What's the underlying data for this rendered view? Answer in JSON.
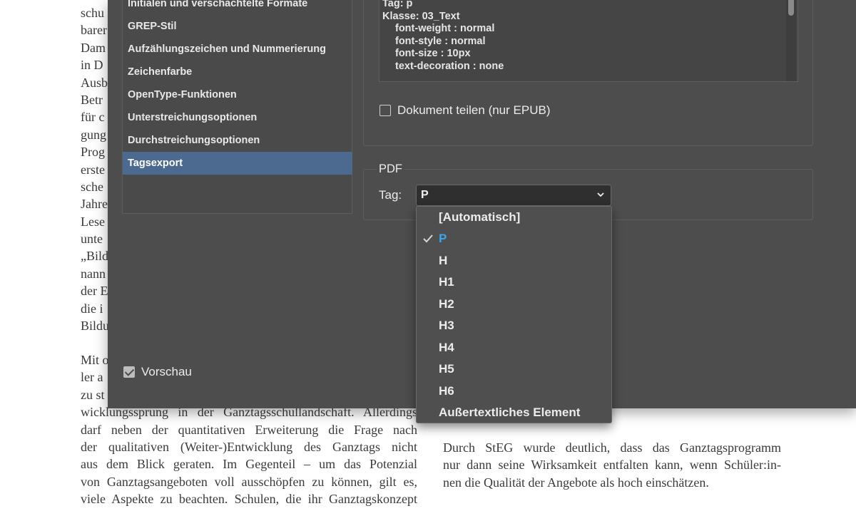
{
  "background_document": {
    "left_column_top": [
      "schu",
      "barer",
      "Dam",
      "in D",
      "Ausb",
      "Betr",
      "für c",
      "gung",
      "Prog",
      "erste",
      "sche",
      "Jahre",
      "Lese",
      "unte",
      "„Bild",
      "nann",
      "der E",
      "die i",
      "Bildu"
    ],
    "left_column_bottom": [
      "Mit o",
      "ler a",
      "zu st",
      "wicklungssprung in der Ganztagsschullandschaft. Allerdings",
      "darf neben der quantitativen Erweiterung die Frage nach",
      "der qualitativen (Weiter-)Entwicklung des Ganztags nicht",
      "aus dem Blick geraten. Im Gegenteil – um das Potenzial",
      "von Ganztagsangeboten voll ausschöpfen zu können, gilt es,",
      "viele Aspekte zu beachten. Schulen, die ihr Ganztagskonzept"
    ],
    "right_column": [
      "Durch StEG wurde deutlich, dass das Ganztagsprogramm",
      "nur dann seine Wirksamkeit entfalten kann, wenn Schüler:in-",
      "nen die Qualität der Angebote als hoch einschätzen."
    ]
  },
  "dialog": {
    "categories": [
      {
        "label": "Initialen und verschachtelte Formate",
        "selected": false
      },
      {
        "label": "GREP-Stil",
        "selected": false
      },
      {
        "label": "Aufzählungszeichen und Nummerierung",
        "selected": false
      },
      {
        "label": "Zeichenfarbe",
        "selected": false
      },
      {
        "label": "OpenType-Funktionen",
        "selected": false
      },
      {
        "label": "Unterstreichungsoptionen",
        "selected": false
      },
      {
        "label": "Durchstreichungsoptionen",
        "selected": false
      },
      {
        "label": "Tagsexport",
        "selected": true
      }
    ],
    "epub": {
      "css_preview": [
        {
          "text": "Tag: p",
          "indent": false
        },
        {
          "text": "Klasse: 03_Text",
          "indent": false
        },
        {
          "text": "font-weight : normal",
          "indent": true
        },
        {
          "text": "font-style : normal",
          "indent": true
        },
        {
          "text": "font-size : 10px",
          "indent": true
        },
        {
          "text": "text-decoration : none",
          "indent": true
        }
      ],
      "split_document_label": "Dokument teilen (nur EPUB)",
      "split_document_checked": false
    },
    "pdf": {
      "legend": "PDF",
      "tag_label": "Tag:",
      "tag_value": "P"
    },
    "preview_label": "Vorschau",
    "preview_checked": true
  },
  "dropdown": {
    "options": [
      {
        "label": "[Automatisch]",
        "selected": false
      },
      {
        "label": "P",
        "selected": true
      },
      {
        "label": "H",
        "selected": false
      },
      {
        "label": "H1",
        "selected": false
      },
      {
        "label": "H2",
        "selected": false
      },
      {
        "label": "H3",
        "selected": false
      },
      {
        "label": "H4",
        "selected": false
      },
      {
        "label": "H5",
        "selected": false
      },
      {
        "label": "H6",
        "selected": false
      },
      {
        "label": "Außertextliches Element",
        "selected": false
      }
    ]
  },
  "colors": {
    "dialog_bg": "#4d4d4d",
    "selection": "#4c6a8f",
    "accent": "#3ba5ee"
  }
}
